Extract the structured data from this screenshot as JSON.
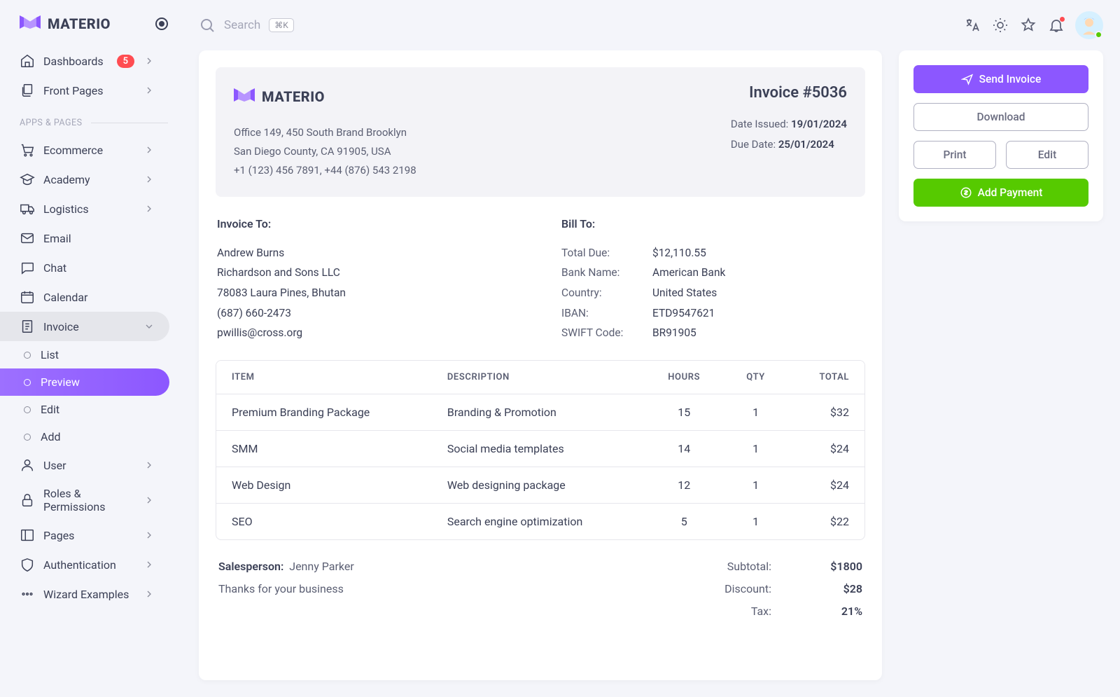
{
  "brand": "MATERIO",
  "search": {
    "placeholder": "Search",
    "kbd": "⌘K"
  },
  "sidebar": {
    "dashboards": {
      "label": "Dashboards",
      "badge": "5"
    },
    "frontpages": {
      "label": "Front Pages"
    },
    "section": "APPS & PAGES",
    "items": [
      {
        "label": "Ecommerce"
      },
      {
        "label": "Academy"
      },
      {
        "label": "Logistics"
      },
      {
        "label": "Email"
      },
      {
        "label": "Chat"
      },
      {
        "label": "Calendar"
      }
    ],
    "invoice": {
      "label": "Invoice",
      "subs": [
        {
          "label": "List"
        },
        {
          "label": "Preview"
        },
        {
          "label": "Edit"
        },
        {
          "label": "Add"
        }
      ]
    },
    "user": {
      "label": "User"
    },
    "roles": {
      "label": "Roles & Permissions"
    },
    "pages": {
      "label": "Pages"
    },
    "auth": {
      "label": "Authentication"
    },
    "wizard": {
      "label": "Wizard Examples"
    }
  },
  "invoice": {
    "from": {
      "addr1": "Office 149, 450 South Brand Brooklyn",
      "addr2": "San Diego County, CA 91905, USA",
      "phone": "+1 (123) 456 7891, +44 (876) 543 2198"
    },
    "number_label": "Invoice #5036",
    "issued_label": "Date Issued: ",
    "issued": "19/01/2024",
    "due_label": "Due Date: ",
    "due": "25/01/2024",
    "to_label": "Invoice To:",
    "to": {
      "name": "Andrew Burns",
      "company": "Richardson and Sons LLC",
      "address": "78083 Laura Pines, Bhutan",
      "phone": "(687) 660-2473",
      "email": "pwillis@cross.org"
    },
    "bill_label": "Bill To:",
    "bill": {
      "total_due_l": "Total Due:",
      "total_due": "$12,110.55",
      "bank_l": "Bank Name:",
      "bank": "American Bank",
      "country_l": "Country:",
      "country": "United States",
      "iban_l": "IBAN:",
      "iban": "ETD9547621",
      "swift_l": "SWIFT Code:",
      "swift": "BR91905"
    },
    "cols": {
      "item": "ITEM",
      "desc": "DESCRIPTION",
      "hours": "HOURS",
      "qty": "QTY",
      "total": "TOTAL"
    },
    "lines": [
      {
        "item": "Premium Branding Package",
        "desc": "Branding & Promotion",
        "hours": "15",
        "qty": "1",
        "total": "$32"
      },
      {
        "item": "SMM",
        "desc": "Social media templates",
        "hours": "14",
        "qty": "1",
        "total": "$24"
      },
      {
        "item": "Web Design",
        "desc": "Web designing package",
        "hours": "12",
        "qty": "1",
        "total": "$24"
      },
      {
        "item": "SEO",
        "desc": "Search engine optimization",
        "hours": "5",
        "qty": "1",
        "total": "$22"
      }
    ],
    "sales_l": "Salesperson:",
    "sales": "Jenny Parker",
    "thanks": "Thanks for your business",
    "totals": {
      "subtotal_l": "Subtotal:",
      "subtotal": "$1800",
      "discount_l": "Discount:",
      "discount": "$28",
      "tax_l": "Tax:",
      "tax": "21%"
    }
  },
  "actions": {
    "send": "Send Invoice",
    "download": "Download",
    "print": "Print",
    "edit": "Edit",
    "add_payment": "Add Payment"
  }
}
